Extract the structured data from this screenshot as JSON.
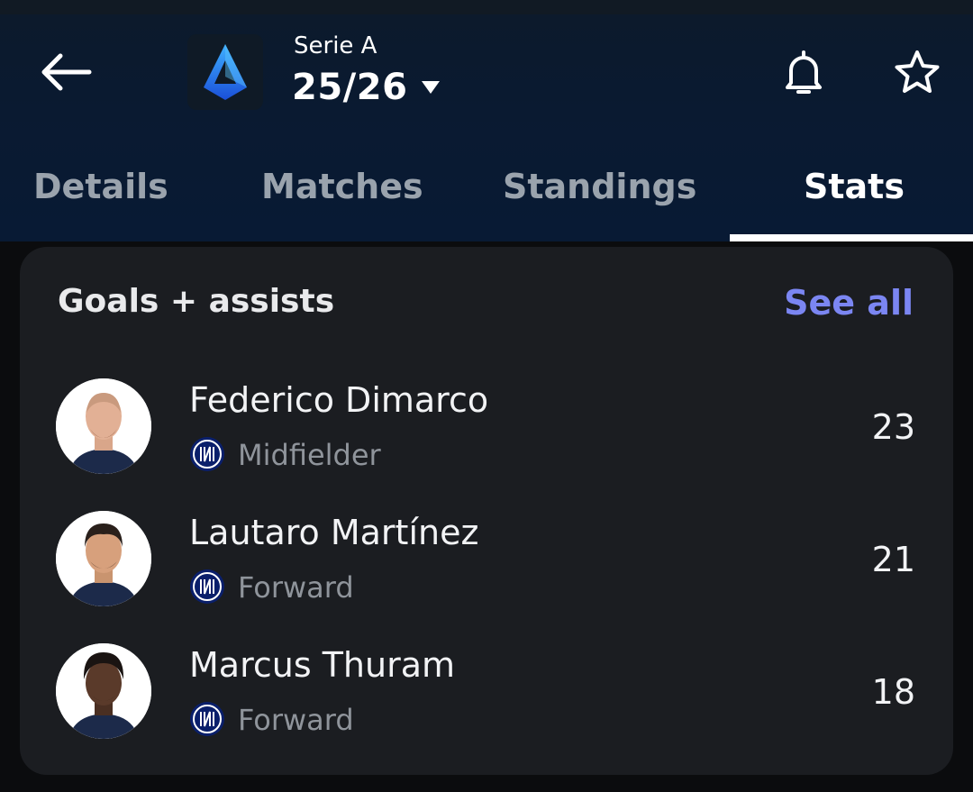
{
  "header": {
    "league_name": "Serie A",
    "season": "25/26",
    "icons": {
      "back": "arrow-left-icon",
      "league_logo": "serie-a-logo",
      "season_caret": "caret-down-icon",
      "notifications": "bell-icon",
      "favorite": "star-icon"
    }
  },
  "tabs": [
    {
      "label": "Details",
      "active": false
    },
    {
      "label": "Matches",
      "active": false
    },
    {
      "label": "Standings",
      "active": false
    },
    {
      "label": "Stats",
      "active": true
    }
  ],
  "card": {
    "title": "Goals + assists",
    "see_all": "See all",
    "players": [
      {
        "name": "Federico Dimarco",
        "position": "Midfielder",
        "team_icon": "inter-badge-icon",
        "value": "23"
      },
      {
        "name": "Lautaro Martínez",
        "position": "Forward",
        "team_icon": "inter-badge-icon",
        "value": "21"
      },
      {
        "name": "Marcus Thuram",
        "position": "Forward",
        "team_icon": "inter-badge-icon",
        "value": "18"
      }
    ]
  },
  "colors": {
    "accent_link": "#7b86f2",
    "card_bg": "#1b1d21",
    "header_bg": "#0a1a31",
    "tab_inactive": "#9aa3ad"
  }
}
